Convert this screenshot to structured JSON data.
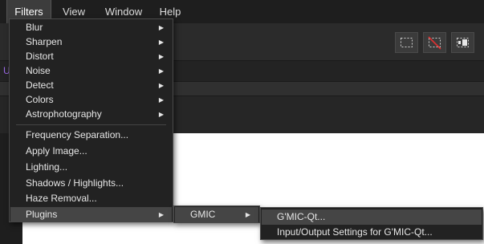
{
  "menubar": {
    "items": [
      {
        "label": "Filters"
      },
      {
        "label": "View"
      },
      {
        "label": "Window"
      },
      {
        "label": "Help"
      }
    ]
  },
  "toolbar": {
    "icons": [
      "marquee-select-icon",
      "deselect-icon",
      "invert-selection-icon"
    ]
  },
  "context": {
    "partial_label": "U"
  },
  "filters_menu": {
    "submenu_items": [
      {
        "label": "Blur"
      },
      {
        "label": "Sharpen"
      },
      {
        "label": "Distort"
      },
      {
        "label": "Noise"
      },
      {
        "label": "Detect"
      },
      {
        "label": "Colors"
      },
      {
        "label": "Astrophotography"
      }
    ],
    "items": [
      {
        "label": "Frequency Separation..."
      },
      {
        "label": "Apply Image..."
      },
      {
        "label": "Lighting..."
      },
      {
        "label": "Shadows / Highlights..."
      },
      {
        "label": "Haze Removal..."
      }
    ],
    "plugins": {
      "label": "Plugins"
    }
  },
  "plugins_menu": {
    "items": [
      {
        "label": "GMIC"
      }
    ]
  },
  "gmic_menu": {
    "items": [
      {
        "label": "G'MIC-Qt..."
      },
      {
        "label": "Input/Output Settings for G'MIC-Qt..."
      }
    ]
  },
  "colors": {
    "menu_bg": "#222222",
    "highlight": "#454545",
    "canvas": "#ffffff",
    "accent_text": "#9d6ae8"
  }
}
